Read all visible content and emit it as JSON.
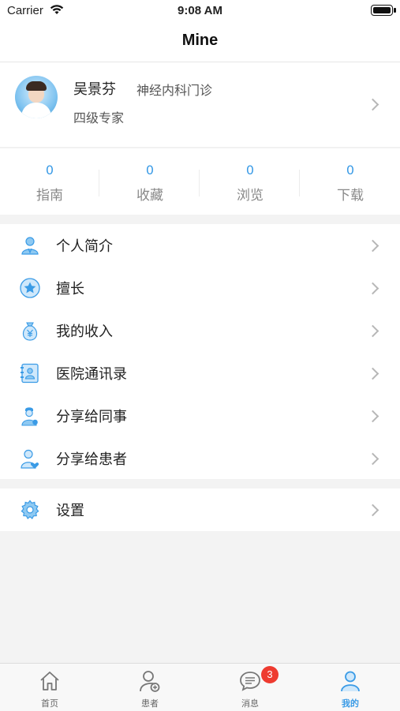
{
  "status_bar": {
    "carrier": "Carrier",
    "time": "9:08 AM"
  },
  "nav": {
    "title": "Mine"
  },
  "profile": {
    "name": "吴景芬",
    "department": "神经内科门诊",
    "title": "四级专家"
  },
  "stats": [
    {
      "value": "0",
      "label": "指南"
    },
    {
      "value": "0",
      "label": "收藏"
    },
    {
      "value": "0",
      "label": "浏览"
    },
    {
      "value": "0",
      "label": "下载"
    }
  ],
  "menu": [
    {
      "label": "个人简介",
      "icon": "user-profile-icon"
    },
    {
      "label": "擅长",
      "icon": "star-badge-icon"
    },
    {
      "label": "我的收入",
      "icon": "money-bag-icon"
    },
    {
      "label": "医院通讯录",
      "icon": "address-book-icon"
    },
    {
      "label": "分享给同事",
      "icon": "doctor-icon"
    },
    {
      "label": "分享给患者",
      "icon": "patient-heart-icon"
    }
  ],
  "settings": {
    "label": "设置",
    "icon": "gear-icon"
  },
  "tabs": [
    {
      "label": "首页",
      "icon": "home-icon"
    },
    {
      "label": "患者",
      "icon": "patient-icon"
    },
    {
      "label": "消息",
      "icon": "message-icon",
      "badge": "3"
    },
    {
      "label": "我的",
      "icon": "person-icon"
    }
  ],
  "colors": {
    "accent": "#3a9be6",
    "badge": "#ee3b30",
    "background": "#f3f3f3"
  }
}
